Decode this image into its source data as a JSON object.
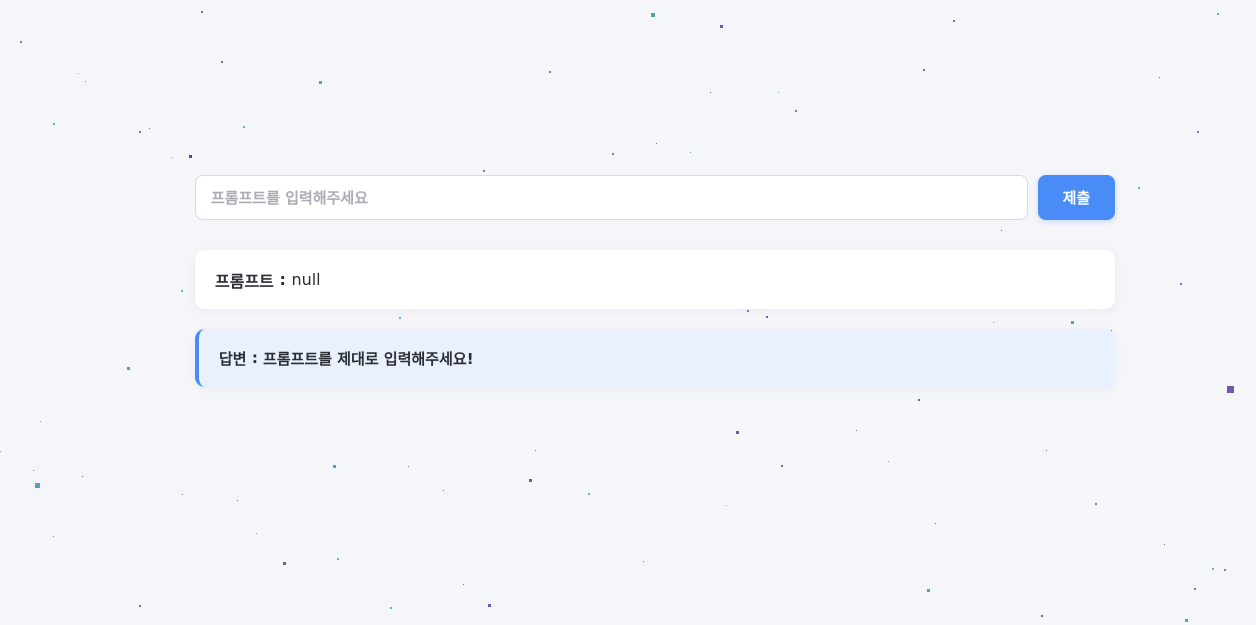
{
  "prompt_form": {
    "input_placeholder": "프롬프트를 입력해주세요",
    "input_value": "",
    "submit_label": "제출"
  },
  "prompt_display": {
    "label": "프롬프트",
    "separator": " : ",
    "value": "null"
  },
  "answer_display": {
    "label": "답변",
    "separator": " : ",
    "value": "프롬프트를 제대로 입력해주세요!"
  },
  "colors": {
    "background": "#f5f6fa",
    "accent": "#4a8cf7",
    "answer_background": "#e8f1fd",
    "star_colors": [
      "#2e2f8f",
      "#3a8fb0",
      "#5b3aa6"
    ]
  }
}
